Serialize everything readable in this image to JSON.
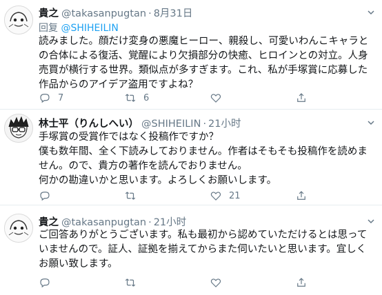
{
  "tweets": [
    {
      "name": "貴之",
      "handle": "@takasanpugtan",
      "time": "8月31日",
      "reply_label": "回复",
      "reply_mention": "@SHIHEILIN",
      "lines": [
        "読みました。顔だけ変身の悪魔ヒーロー、親殺し、可愛いわんこキャラと",
        "の合体による復活、覚醒により欠損部分の快癒、ヒロインとの対立。人身",
        "売買が横行する世界。類似点が多すぎます。これ、私が手塚賞に応募した",
        "作品からのアイデア盗用ですよね？"
      ],
      "counts": {
        "reply": "7",
        "retweet": "6",
        "like": "",
        "share": ""
      }
    },
    {
      "name": "林士平（りんしへい）",
      "handle": "@SHIHEILIN",
      "time": "21小时",
      "lines": [
        "手塚賞の受賞作ではなく投稿作ですか？",
        "僕も数年間、全く下読みしておりません。作者はそもそも投稿作を読めま",
        "せん。ので、貴方の著作を読んでおりません。",
        "何かの勘違いかと思います。よろしくお願いします。"
      ],
      "counts": {
        "reply": "",
        "retweet": "",
        "like": "21",
        "share": ""
      }
    },
    {
      "name": "貴之",
      "handle": "@takasanpugtan",
      "time": "21小时",
      "lines": [
        "ご回答ありがとうございます。私も最初から認めていただけるとは思って",
        "いませんので。証人、証拠を揃えてからまた伺いたいと思います。宜しく",
        "お願い致します。"
      ],
      "counts": {
        "reply": "",
        "retweet": "",
        "like": "",
        "share": ""
      }
    }
  ],
  "colors": {
    "link": "#1da1f2",
    "muted": "#657786",
    "text": "#14171a",
    "separator": "#e6ecf0"
  },
  "icons": [
    "reply-icon",
    "retweet-icon",
    "like-icon",
    "share-icon",
    "caret-down-icon"
  ]
}
